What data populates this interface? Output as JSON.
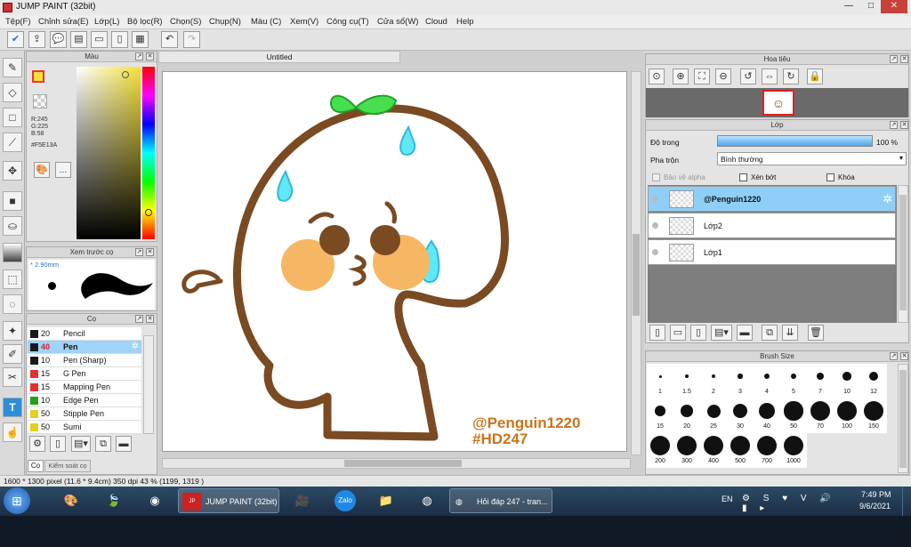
{
  "title": "JUMP PAINT (32bit)",
  "menu": [
    "Tệp(F)",
    "Chỉnh sửa(E)",
    "Lớp(L)",
    "Bộ lọc(R)",
    "Chọn(S)",
    "Chụp(N)",
    "Màu (C)",
    "Xem(V)",
    "Công cụ(T)",
    "Cửa sổ(W)",
    "Cloud",
    "Help"
  ],
  "color_panel": {
    "title": "Màu",
    "r": "R:245",
    "g": "G:225",
    "b": "B:58",
    "hex": "#F5E13A",
    "fg": "#F5E13A"
  },
  "preview_panel": {
    "title": "Xem trước cọ",
    "size": "* 2.90mm"
  },
  "brush_panel": {
    "title": "Cọ",
    "brushes": [
      {
        "size": "20",
        "name": "Pencil",
        "color": "#1a1a1a",
        "selected": false
      },
      {
        "size": "40",
        "name": "Pen",
        "color": "#1a1a1a",
        "selected": true
      },
      {
        "size": "10",
        "name": "Pen (Sharp)",
        "color": "#1a1a1a",
        "selected": false
      },
      {
        "size": "15",
        "name": "G Pen",
        "color": "#e03030",
        "selected": false
      },
      {
        "size": "15",
        "name": "Mapping Pen",
        "color": "#e03030",
        "selected": false
      },
      {
        "size": "10",
        "name": "Edge Pen",
        "color": "#20a020",
        "selected": false
      },
      {
        "size": "50",
        "name": "Stipple Pen",
        "color": "#e0d020",
        "selected": false
      },
      {
        "size": "50",
        "name": "Sumi",
        "color": "#e0d020",
        "selected": false
      }
    ],
    "tab1": "Cọ",
    "tab2": "Kiểm soát cọ"
  },
  "document": {
    "tab": "Untitled",
    "watermark1": "@Penguin1220",
    "watermark2": "#HD247"
  },
  "navigator": {
    "title": "Hoa tiêu"
  },
  "layers_panel": {
    "title": "Lớp",
    "opacity_label": "Độ trong",
    "opacity_value": "100 %",
    "opacity": 1.0,
    "blend_label": "Pha trộn",
    "blend_value": "Bình thường",
    "protect_alpha": "Bảo vệ alpha",
    "clipping": "Xén bớt",
    "lock": "Khóa",
    "layers": [
      {
        "name": "@Penguin1220",
        "selected": true
      },
      {
        "name": "Lớp2",
        "selected": false
      },
      {
        "name": "Lớp1",
        "selected": false
      }
    ]
  },
  "brush_size": {
    "title": "Brush Size",
    "sizes": [
      "1",
      "1.5",
      "2",
      "3",
      "4",
      "5",
      "7",
      "10",
      "12",
      "15",
      "20",
      "25",
      "30",
      "40",
      "50",
      "70",
      "100",
      "150",
      "200",
      "300",
      "400",
      "500",
      "700",
      "1000"
    ]
  },
  "status": {
    "info": "1600 * 1300 pixel  (11.6 * 9.4cm)  350 dpi  43 %  (1199, 1319 )"
  },
  "taskbar": {
    "app1": "JUMP PAINT (32bit)",
    "app2": "Hỏi đáp 247 - tran...",
    "lang": "EN",
    "time": "7:49 PM",
    "date": "9/6/2021",
    "zalo": "Zalo"
  }
}
